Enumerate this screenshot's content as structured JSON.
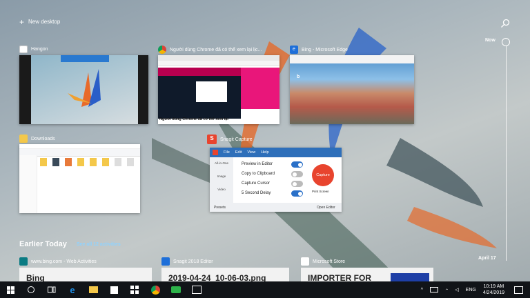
{
  "header": {
    "new_desktop": "New desktop"
  },
  "timeline": {
    "now": "Now",
    "april": "April 17"
  },
  "windows": [
    {
      "title": "Hangon"
    },
    {
      "title": "Người dùng Chrome đã có thể xem lại lịc..."
    },
    {
      "title": "Bing - Microsoft Edge"
    },
    {
      "title": "Downloads"
    },
    {
      "title": "Snagit Capture"
    }
  ],
  "chrome_thumb": {
    "headline": "Người dùng Chrome đã có thể xem lại"
  },
  "snagit": {
    "menu": [
      "File",
      "Edit",
      "View",
      "Help"
    ],
    "side": [
      "All-in-One",
      "Image",
      "Video"
    ],
    "options": [
      {
        "label": "Preview in Editor",
        "on": true
      },
      {
        "label": "Copy to Clipboard",
        "on": false
      },
      {
        "label": "Capture Cursor",
        "on": false
      },
      {
        "label": "5 Second Delay",
        "on": true
      }
    ],
    "capture": "Capture",
    "print_screen": "Print Screen",
    "presets": "Presets",
    "open_editor": "Open Editor"
  },
  "earlier": {
    "title": "Earlier Today",
    "see_all": "See all 12 activities"
  },
  "cards": [
    {
      "source": "www.bing.com - Web Activities",
      "text": "Bing"
    },
    {
      "source": "Snagit 2018 Editor",
      "text": "2019-04-24_10-06-03.png"
    },
    {
      "source": "Microsoft Store",
      "text": "IMPORTER FOR"
    }
  ],
  "tray": {
    "lang": "ENG",
    "time": "10:19 AM",
    "date": "4/24/2019"
  },
  "colors": {
    "snagit_red": "#e8442e",
    "edge_blue": "#1e6fd9",
    "toggle_on": "#2a70c8"
  }
}
